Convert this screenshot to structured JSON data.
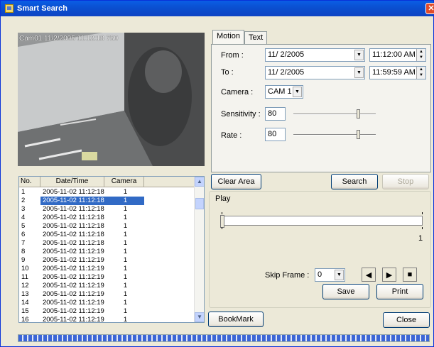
{
  "window": {
    "title": "Smart Search",
    "close_glyph": "✕"
  },
  "video": {
    "overlay": "Cam01 11/2/2005 11:12:18 750"
  },
  "tabs": [
    {
      "label": "Motion"
    },
    {
      "label": "Text"
    }
  ],
  "motion": {
    "from_label": "From :",
    "from_date": "11/ 2/2005",
    "from_time": "11:12:00 AM",
    "to_label": "To :",
    "to_date": "11/ 2/2005",
    "to_time": "11:59:59 AM",
    "camera_label": "Camera :",
    "camera_value": "CAM 1",
    "sensitivity_label": "Sensitivity :",
    "sensitivity_value": "80",
    "sensitivity_level": 0.8,
    "rate_label": "Rate :",
    "rate_value": "80",
    "rate_level": 0.8
  },
  "results": {
    "columns": [
      "No.",
      "Date/Time",
      "Camera"
    ],
    "rows": [
      [
        "1",
        "2005-11-02 11:12:18",
        "1"
      ],
      [
        "2",
        "2005-11-02 11:12:18",
        "1"
      ],
      [
        "3",
        "2005-11-02 11:12:18",
        "1"
      ],
      [
        "4",
        "2005-11-02 11:12:18",
        "1"
      ],
      [
        "5",
        "2005-11-02 11:12:18",
        "1"
      ],
      [
        "6",
        "2005-11-02 11:12:18",
        "1"
      ],
      [
        "7",
        "2005-11-02 11:12:18",
        "1"
      ],
      [
        "8",
        "2005-11-02 11:12:19",
        "1"
      ],
      [
        "9",
        "2005-11-02 11:12:19",
        "1"
      ],
      [
        "10",
        "2005-11-02 11:12:19",
        "1"
      ],
      [
        "11",
        "2005-11-02 11:12:19",
        "1"
      ],
      [
        "12",
        "2005-11-02 11:12:19",
        "1"
      ],
      [
        "13",
        "2005-11-02 11:12:19",
        "1"
      ],
      [
        "14",
        "2005-11-02 11:12:19",
        "1"
      ],
      [
        "15",
        "2005-11-02 11:12:19",
        "1"
      ],
      [
        "16",
        "2005-11-02 11:12:19",
        "1"
      ]
    ],
    "selected_index": 1
  },
  "buttons": {
    "clear_area": "Clear Area",
    "search": "Search",
    "stop": "Stop",
    "save": "Save",
    "print": "Print",
    "bookmark": "BookMark",
    "close": "Close"
  },
  "play": {
    "title": "Play",
    "position_label": "1",
    "skip_label": "Skip Frame :",
    "skip_value": "0"
  },
  "colors": {
    "title_bar": "#0a5ee5",
    "selection": "#316ac5",
    "dialog_bg": "#ece9d8",
    "progress": "#3c66d6"
  }
}
